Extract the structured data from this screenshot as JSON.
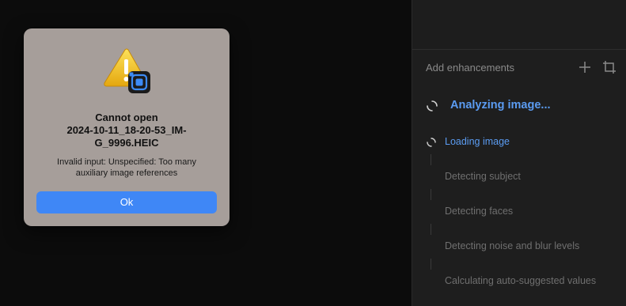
{
  "panel": {
    "header_label": "Add enhancements",
    "add_icon": "plus-icon",
    "crop_icon": "crop-icon",
    "analyzing_label": "Analyzing image...",
    "steps": [
      {
        "label": "Loading image",
        "state": "active"
      },
      {
        "label": "Detecting subject",
        "state": "pending"
      },
      {
        "label": "Detecting faces",
        "state": "pending"
      },
      {
        "label": "Detecting noise and blur levels",
        "state": "pending"
      },
      {
        "label": "Calculating auto-suggested values",
        "state": "pending"
      }
    ],
    "accent_color": "#5b9cf2",
    "muted_color": "#6f6f6f"
  },
  "dialog": {
    "icon": "warning-icon",
    "app_badge_icon": "app-badge-icon",
    "title_line1": "Cannot open",
    "title_line2": "2024-10-11_18-20-53_IM-",
    "title_line3": "G_9996.HEIC",
    "message_line1": "Invalid input: Unspecified: Too many",
    "message_line2": "auxiliary image references",
    "ok_label": "Ok",
    "button_color": "#3f87f6",
    "background_color": "#a69e9a"
  }
}
